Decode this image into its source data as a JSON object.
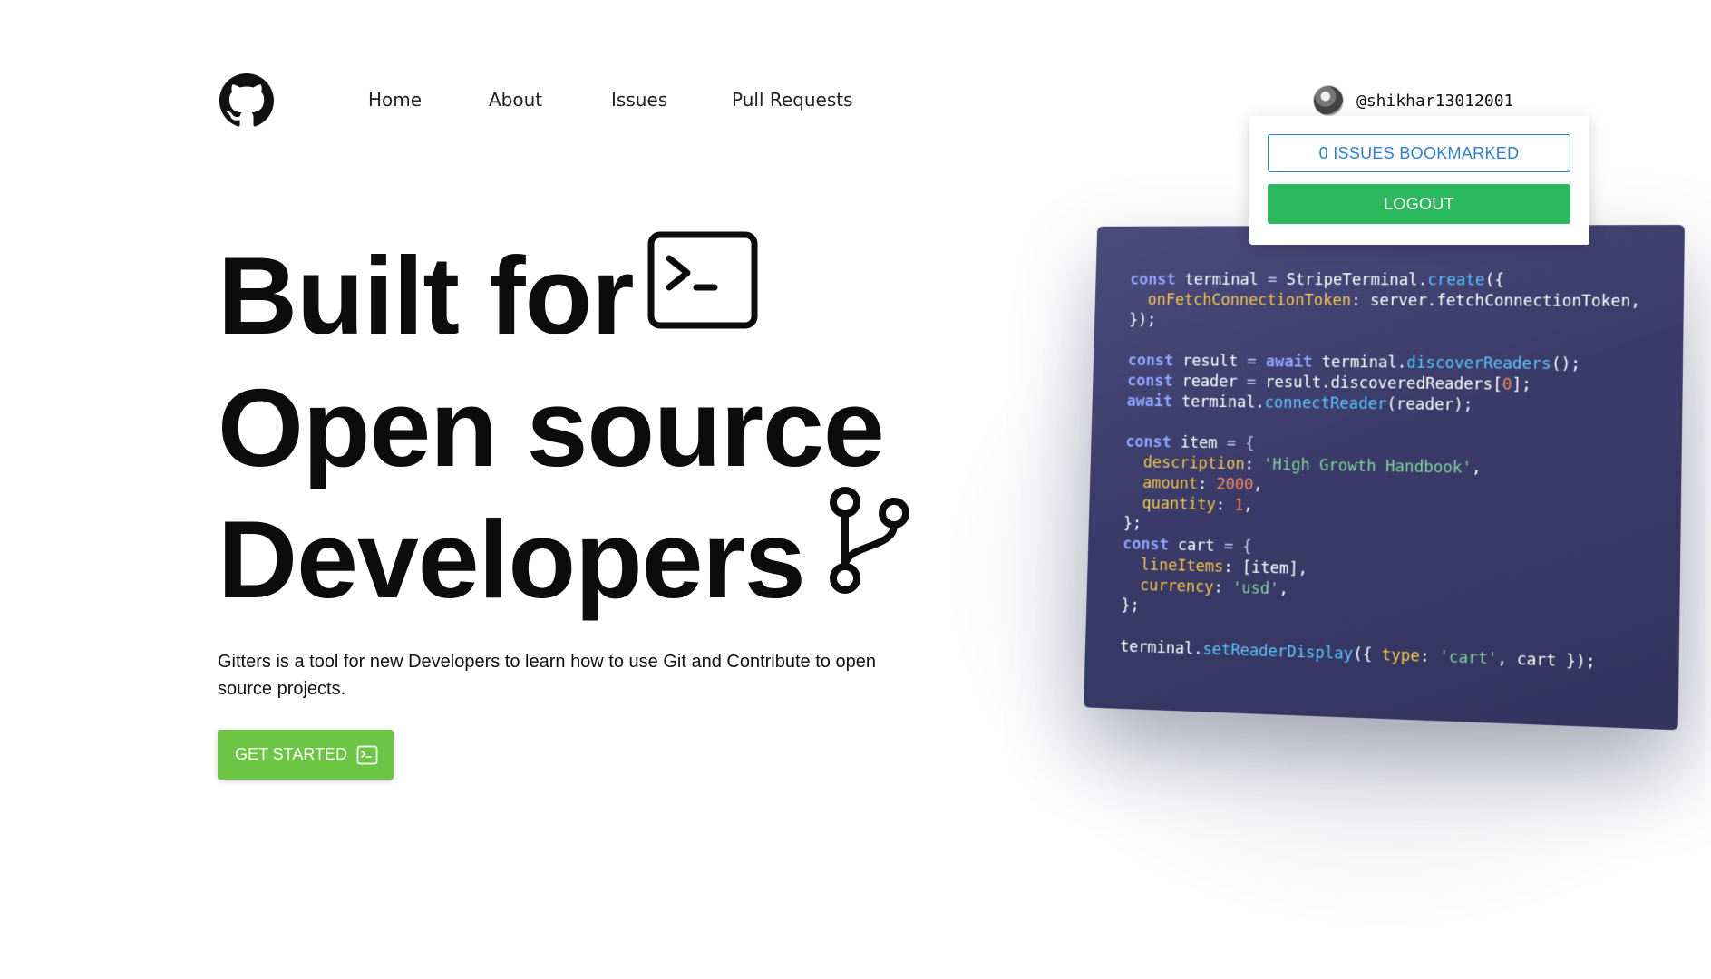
{
  "nav": {
    "links": [
      "Home",
      "About",
      "Issues",
      "Pull Requests"
    ]
  },
  "user": {
    "handle": "@shikhar13012001"
  },
  "dropdown": {
    "bookmarked_label": "0 ISSUES BOOKMARKED",
    "logout_label": "LOGOUT"
  },
  "hero": {
    "line1": "Built for",
    "line2": "Open source",
    "line3": "Developers",
    "description": "Gitters is a tool for new Developers to learn how to use Git and Contribute to open source projects.",
    "cta_label": "GET STARTED"
  },
  "code": {
    "line_1": {
      "kw": "const",
      "a": " terminal ",
      "b": "=",
      "c": " StripeTerminal.",
      "fn": "create",
      "d": "({"
    },
    "line_2": {
      "prop": "onFetchConnectionToken",
      "a": ": server.fetchConnectionToken,"
    },
    "line_3": "});",
    "line_4": {
      "kw": "const",
      "a": " result ",
      "b": "=",
      "kw2": " await",
      "c": " terminal.",
      "fn": "discoverReaders",
      "d": "();"
    },
    "line_5": {
      "kw": "const",
      "a": " reader ",
      "b": "=",
      "c": " result.discoveredReaders[",
      "num": "0",
      "d": "];"
    },
    "line_6": {
      "kw": "await",
      "a": " terminal.",
      "fn": "connectReader",
      "b": "(reader);"
    },
    "line_7": {
      "kw": "const",
      "a": " item ",
      "b": "= {"
    },
    "line_8": {
      "prop": "description",
      "a": ": ",
      "str": "'High Growth Handbook'",
      "b": ","
    },
    "line_9": {
      "prop": "amount",
      "a": ": ",
      "num": "2000",
      "b": ","
    },
    "line_10": {
      "prop": "quantity",
      "a": ": ",
      "num": "1",
      "b": ","
    },
    "line_11": "};",
    "line_12": {
      "kw": "const",
      "a": " cart ",
      "b": "= {"
    },
    "line_13": {
      "prop": "lineItems",
      "a": ": [item],"
    },
    "line_14": {
      "prop": "currency",
      "a": ": ",
      "str": "'usd'",
      "b": ","
    },
    "line_15": "};",
    "line_16": {
      "a": "terminal.",
      "fn": "setReaderDisplay",
      "b": "({ ",
      "prop": "type",
      "c": ": ",
      "str": "'cart'",
      "d": ", cart });"
    }
  },
  "colors": {
    "accent_green": "#6cc644",
    "logout_green": "#2cb85c",
    "bookmark_blue": "#2b7fd8",
    "code_bg": "#3b3b69"
  },
  "icons": [
    "github-logo-icon",
    "terminal-icon",
    "git-branch-icon",
    "terminal-small-icon",
    "avatar"
  ]
}
